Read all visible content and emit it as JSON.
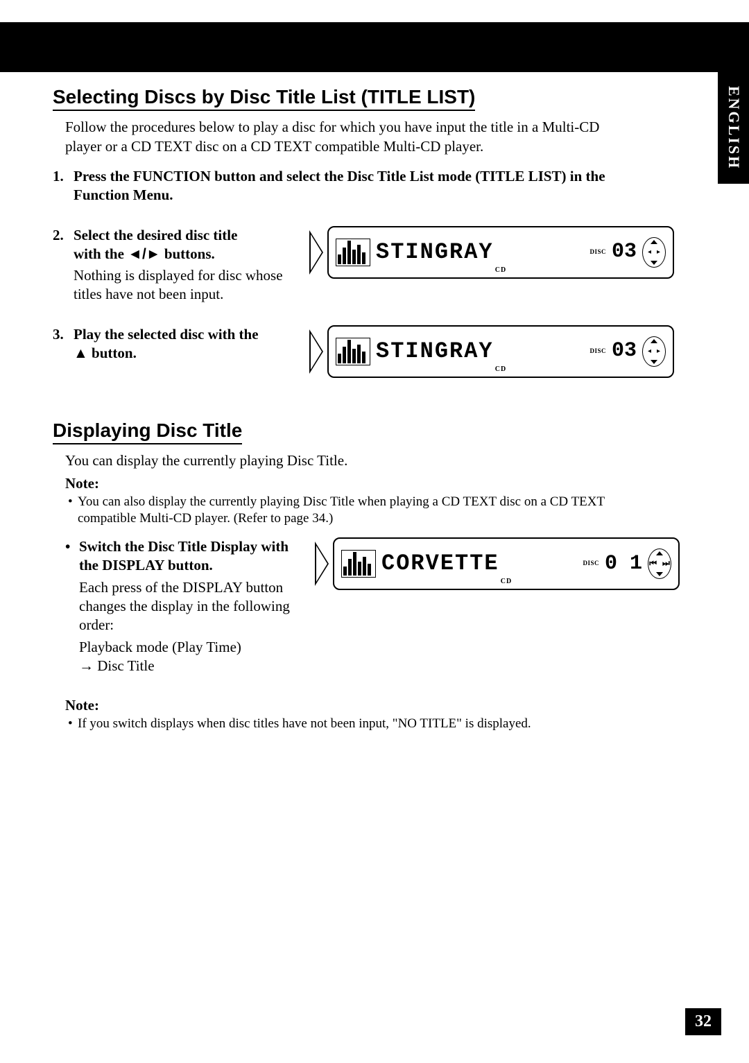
{
  "language_tab": "ENGLISH",
  "page_number": "32",
  "section1": {
    "title": "Selecting Discs by Disc Title List (TITLE LIST)",
    "intro": "Follow the procedures below to play a disc for which you have input the title in a Multi-CD player or a CD TEXT disc on a CD TEXT compatible Multi-CD player.",
    "step1": {
      "num": "1.",
      "text": "Press the FUNCTION button and select the Disc Title List mode (TITLE LIST) in the Function Menu."
    },
    "step2": {
      "num": "2.",
      "title_a": "Select the desired disc title",
      "title_b": "with the ",
      "title_c": " buttons.",
      "arrows": "◄/►",
      "desc": "Nothing is displayed for disc whose titles have not been input.",
      "lcd_text": "STINGRAY",
      "lcd_sub": "CD",
      "lcd_disc_label": "DISC",
      "lcd_num": "03"
    },
    "step3": {
      "num": "3.",
      "title_a": "Play the selected disc with the",
      "title_b": " button.",
      "arrow": "▲",
      "lcd_text": "STINGRAY",
      "lcd_sub": "CD",
      "lcd_disc_label": "DISC",
      "lcd_num": "03"
    }
  },
  "section2": {
    "title": "Displaying Disc Title",
    "intro": "You can display the currently playing Disc Title.",
    "note1_label": "Note:",
    "note1_text": "You can also display the currently playing Disc Title when playing a CD TEXT disc on a CD TEXT compatible Multi-CD player. (Refer to page 34.)",
    "bullet1": {
      "title": "Switch the Disc Title Display with the DISPLAY button.",
      "desc1": "Each press of the DISPLAY button changes the display in the following order:",
      "desc2a": "Playback mode (Play Time)",
      "desc2b": " Disc Title",
      "arrow": "→",
      "lcd_text": "CORVETTE",
      "lcd_sub": "CD",
      "lcd_disc_label": "DISC",
      "lcd_num": "0 1"
    },
    "note2_label": "Note:",
    "note2_text": "If you switch displays when disc titles have not been input, \"NO TITLE\" is displayed."
  }
}
